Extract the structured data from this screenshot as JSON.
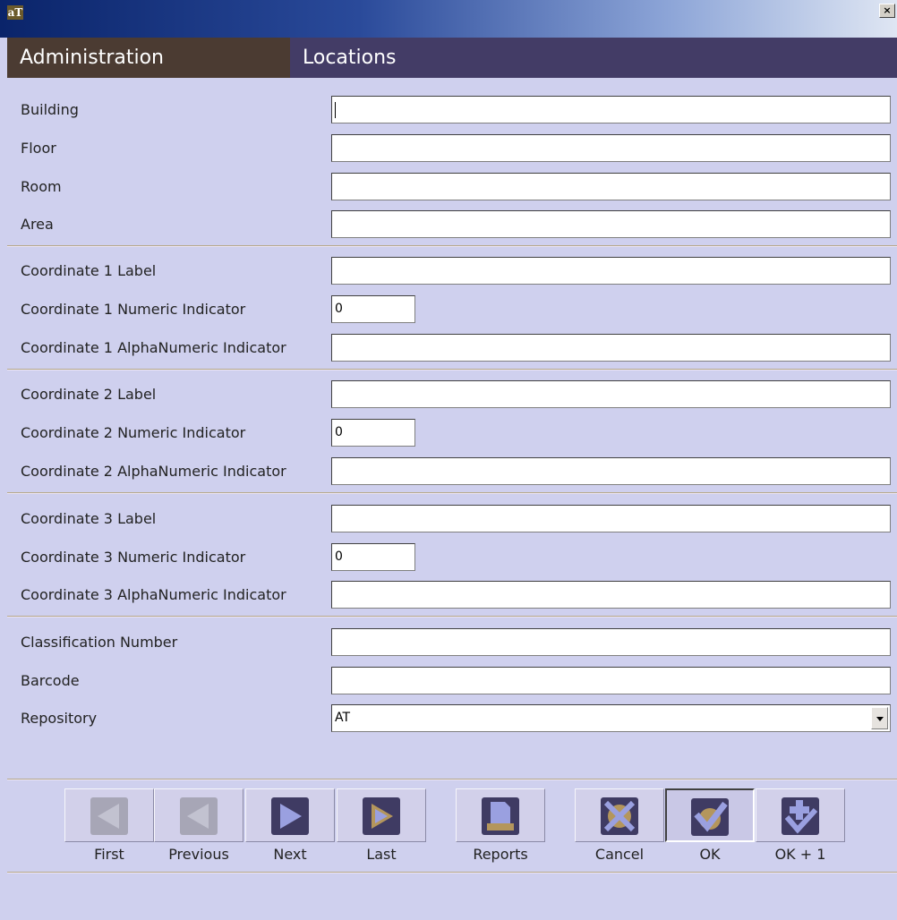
{
  "window": {
    "app_icon_text": "aT",
    "close_glyph": "×"
  },
  "header": {
    "section": "Administration",
    "title": "Locations"
  },
  "fields": {
    "building": {
      "label": "Building",
      "value": ""
    },
    "floor": {
      "label": "Floor",
      "value": ""
    },
    "room": {
      "label": "Room",
      "value": ""
    },
    "area": {
      "label": "Area",
      "value": ""
    },
    "c1_label": {
      "label": "Coordinate 1 Label",
      "value": ""
    },
    "c1_num": {
      "label": "Coordinate 1 Numeric Indicator",
      "value": "0"
    },
    "c1_alpha": {
      "label": "Coordinate 1 AlphaNumeric Indicator",
      "value": ""
    },
    "c2_label": {
      "label": "Coordinate 2 Label",
      "value": ""
    },
    "c2_num": {
      "label": "Coordinate 2 Numeric Indicator",
      "value": "0"
    },
    "c2_alpha": {
      "label": "Coordinate 2 AlphaNumeric Indicator",
      "value": ""
    },
    "c3_label": {
      "label": "Coordinate 3 Label",
      "value": ""
    },
    "c3_num": {
      "label": "Coordinate 3 Numeric Indicator",
      "value": "0"
    },
    "c3_alpha": {
      "label": "Coordinate 3 AlphaNumeric Indicator",
      "value": ""
    },
    "classification": {
      "label": "Classification Number",
      "value": ""
    },
    "barcode": {
      "label": "Barcode",
      "value": ""
    },
    "repository": {
      "label": "Repository",
      "value": "AT"
    }
  },
  "toolbar": {
    "first": "First",
    "previous": "Previous",
    "next": "Next",
    "last": "Last",
    "reports": "Reports",
    "cancel": "Cancel",
    "ok": "OK",
    "ok_plus_one": "OK + 1"
  },
  "colors": {
    "background": "#cfd0ee",
    "header_admin": "#4b3b32",
    "header_title": "#433c66",
    "icon_active": "#3f3b63",
    "icon_disabled": "#a7a6b6",
    "icon_arrow": "#9aa0e0",
    "icon_accent": "#b4965c"
  }
}
